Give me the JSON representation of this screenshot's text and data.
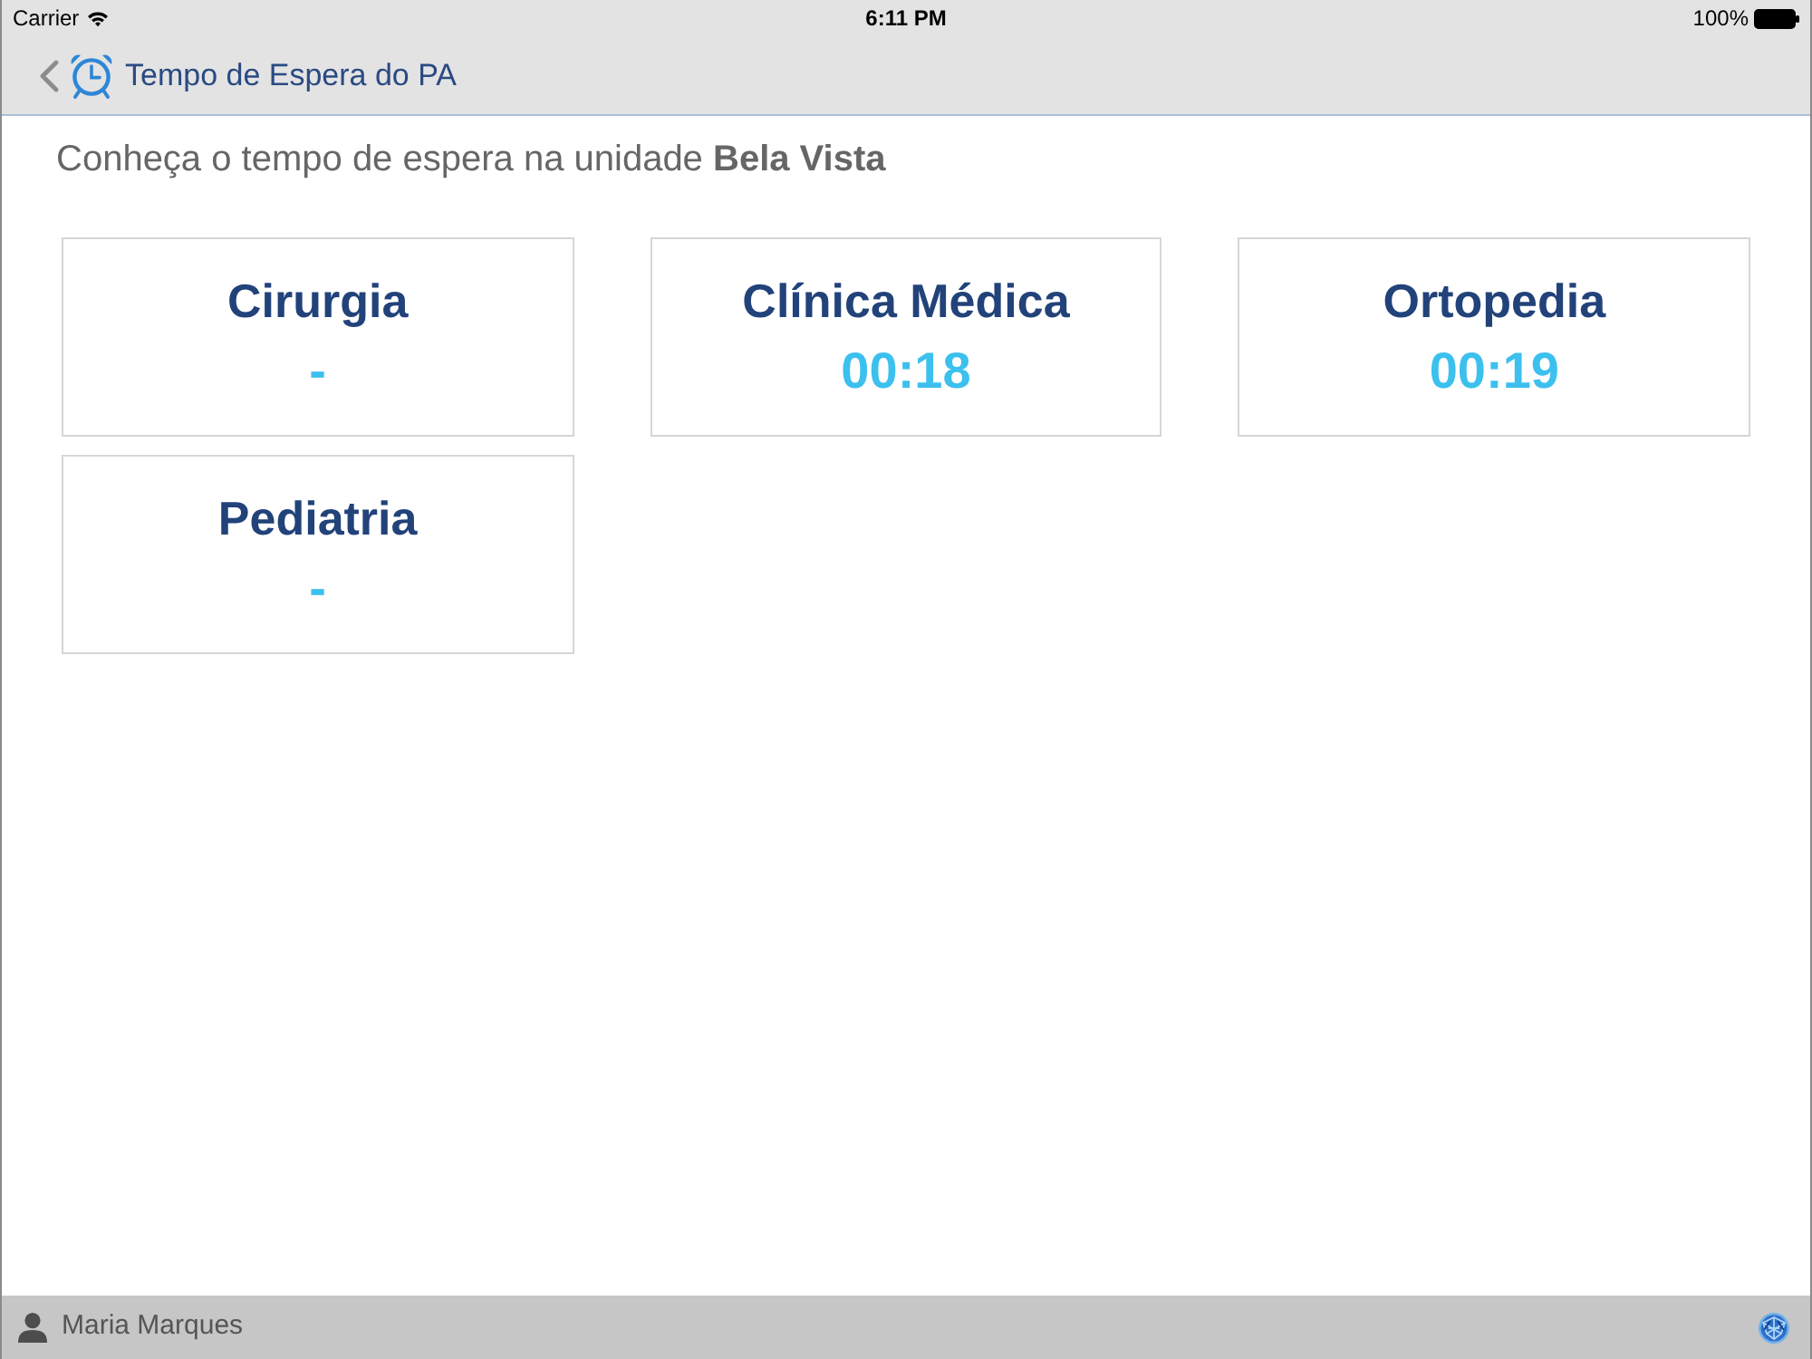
{
  "status_bar": {
    "carrier": "Carrier",
    "time": "6:11 PM",
    "battery": "100%"
  },
  "nav_bar": {
    "title": "Tempo de Espera do PA"
  },
  "subtitle": "Conheça o tempo de espera na unidade **Bela Vista**",
  "cards": [
    {
      "title": "Cirurgia",
      "wait_time": "-"
    },
    {
      "title": "Clínica Médica",
      "wait_time": "00:18"
    },
    {
      "title": "Ortopedia",
      "wait_time": "00:19"
    },
    {
      "title": "Pediatria",
      "wait_time": "-"
    }
  ],
  "footer": {
    "user": "Maria Marques"
  }
}
